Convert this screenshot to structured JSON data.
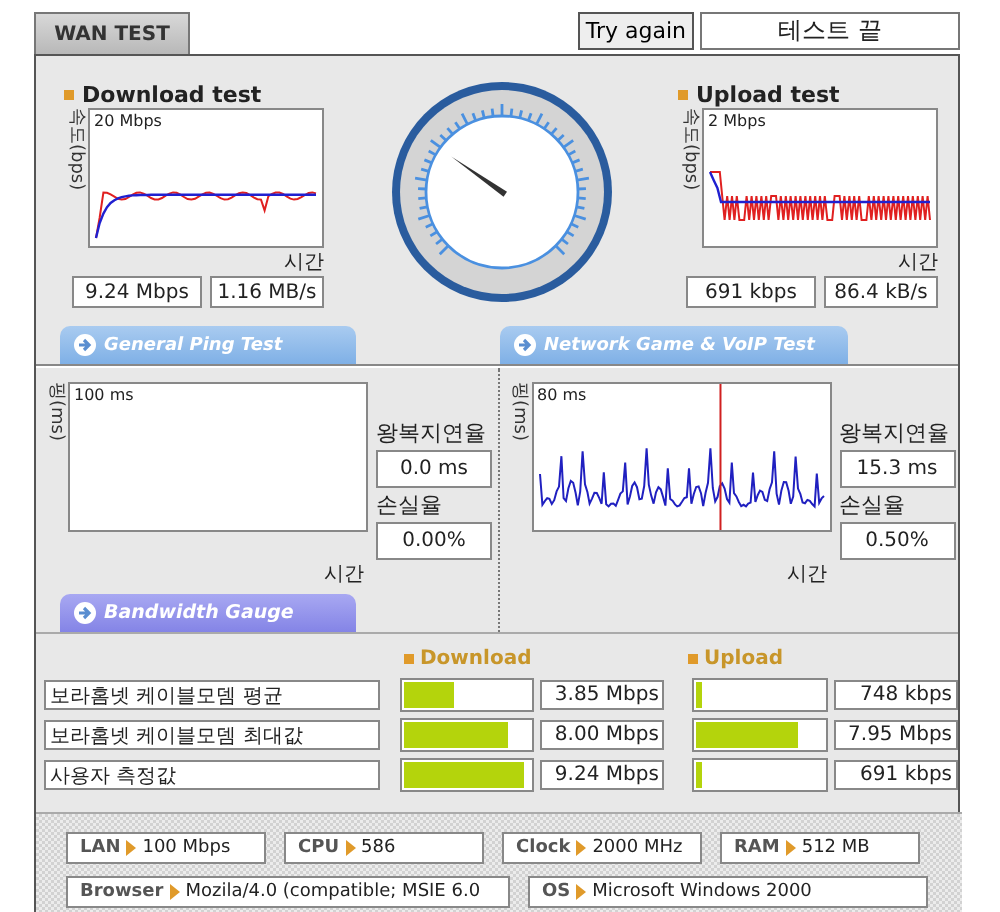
{
  "tab": {
    "label": "WAN TEST"
  },
  "retry_button": "Try again",
  "status": "테스트 끝",
  "download": {
    "title": "Download test",
    "y_axis": "속도(bps)",
    "top": "20 Mbps",
    "x_axis": "시간",
    "readings": [
      "9.24 Mbps",
      "1.16 MB/s"
    ]
  },
  "upload": {
    "title": "Upload test",
    "y_axis": "속도(bps)",
    "top": "2 Mbps",
    "x_axis": "시간",
    "readings": [
      "691 kbps",
      "86.4 kB/s"
    ]
  },
  "ping_sections": [
    {
      "title": "General Ping Test",
      "y_axis": "핑(ms)",
      "top": "100 ms",
      "x_axis": "시간",
      "latency_label": "왕복지연율",
      "latency": "0.0 ms",
      "loss_label": "손실율",
      "loss": "0.00%",
      "kind": "empty"
    },
    {
      "title": "Network Game & VoIP Test",
      "y_axis": "핑(ms)",
      "top": "80 ms",
      "x_axis": "시간",
      "latency_label": "왕복지연율",
      "latency": "15.3 ms",
      "loss_label": "손실율",
      "loss": "0.50%",
      "kind": "spikes"
    }
  ],
  "bandwidth": {
    "title": "Bandwidth Gauge",
    "download_label": "Download",
    "upload_label": "Upload",
    "rows": [
      {
        "name": "보라홈넷 케이블모뎀 평균",
        "download": {
          "level": 0.4,
          "reading": "3.85 Mbps"
        },
        "upload": {
          "level": 0.05,
          "reading": "748 kbps"
        }
      },
      {
        "name": "보라홈넷 케이블모뎀 최대값",
        "download": {
          "level": 0.82,
          "reading": "8.00 Mbps"
        },
        "upload": {
          "level": 0.8,
          "reading": "7.95 Mbps"
        }
      },
      {
        "name": "사용자 측정값",
        "download": {
          "level": 0.95,
          "reading": "9.24 Mbps"
        },
        "upload": {
          "level": 0.05,
          "reading": "691 kbps"
        }
      }
    ]
  },
  "system": [
    {
      "label": "LAN",
      "value": "100 Mbps"
    },
    {
      "label": "CPU",
      "value": "586"
    },
    {
      "label": "Clock",
      "value": "2000 MHz"
    },
    {
      "label": "RAM",
      "value": "512 MB"
    },
    {
      "label": "Browser",
      "value": "Mozila/4.0 (compatible; MSIE 6.0"
    },
    {
      "label": "OS",
      "value": "Microsoft Windows 2000"
    }
  ]
}
